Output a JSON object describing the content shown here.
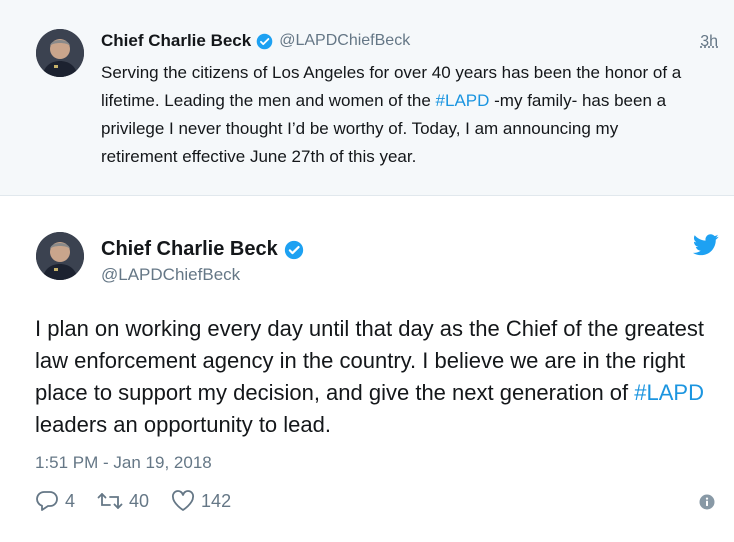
{
  "parent_tweet": {
    "name": "Chief Charlie Beck",
    "handle": "@LAPDChiefBeck",
    "time": "3h",
    "text_part1": "Serving the citizens of Los Angeles for over 40 years has been the honor of a lifetime. Leading the men and women of the ",
    "hashtag": "#LAPD",
    "text_part2": " -my family- has been a privilege I never thought I’d be worthy of. Today, I am announcing my retirement effective June 27th of this year."
  },
  "main_tweet": {
    "name": "Chief Charlie Beck",
    "handle": "@LAPDChiefBeck",
    "text_part1": "I plan on working every day until that day as the Chief of the greatest law enforcement agency in the country. I believe we are in the right place to support my decision, and give the next generation of ",
    "hashtag": "#LAPD",
    "text_part2": " leaders an opportunity to lead.",
    "timestamp": "1:51 PM - Jan 19, 2018",
    "replies": "4",
    "retweets": "40",
    "likes": "142"
  },
  "icons": {
    "verified": "verified-badge-icon",
    "bird": "twitter-bird-icon",
    "reply": "reply-icon",
    "retweet": "retweet-icon",
    "like": "heart-icon",
    "info": "info-icon"
  },
  "colors": {
    "link": "#1b95e0",
    "muted": "#657786",
    "text": "#14171a",
    "parent_bg": "#f5f8fa"
  }
}
